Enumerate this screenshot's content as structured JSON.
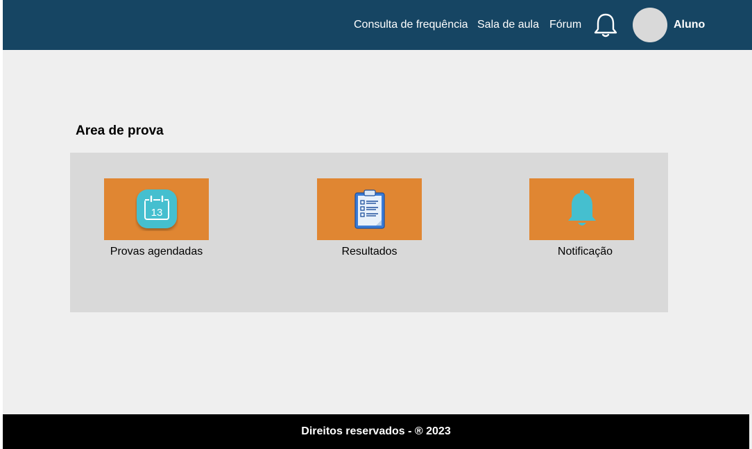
{
  "header": {
    "nav": {
      "consulta": "Consulta de frequência",
      "sala": "Sala de aula",
      "forum": "Fórum"
    },
    "notification_icon": "bell-outline-icon",
    "user": {
      "name": "Aluno"
    }
  },
  "main": {
    "section_title": "Area de prova",
    "cards": [
      {
        "label": "Provas agendadas",
        "icon": "calendar-icon",
        "icon_text": "13"
      },
      {
        "label": "Resultados",
        "icon": "clipboard-checklist-icon"
      },
      {
        "label": "Notificação",
        "icon": "bell-icon"
      }
    ]
  },
  "footer": {
    "text": "Direitos reservados - ® 2023"
  },
  "colors": {
    "header_bg": "#164563",
    "page_bg": "#efefef",
    "panel_bg": "#d9d9d9",
    "tile_bg": "#e08632",
    "icon_accent": "#45bfcf",
    "footer_bg": "#000000"
  }
}
